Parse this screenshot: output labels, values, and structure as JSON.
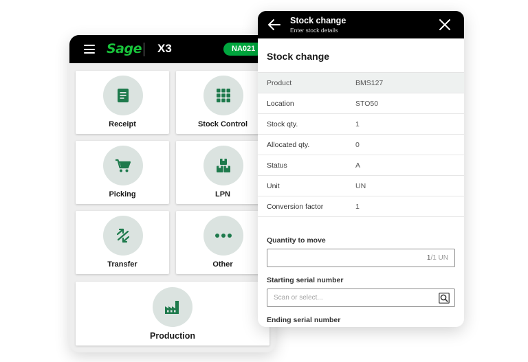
{
  "menu_app": {
    "brand": "Sage",
    "product": "X3",
    "site_badge": "NA021",
    "tiles": [
      {
        "label": "Receipt",
        "icon": "document-icon"
      },
      {
        "label": "Stock Control",
        "icon": "grid-icon"
      },
      {
        "label": "Picking",
        "icon": "cart-icon"
      },
      {
        "label": "LPN",
        "icon": "boxes-icon"
      },
      {
        "label": "Transfer",
        "icon": "transfer-arrows-icon"
      },
      {
        "label": "Other",
        "icon": "more-dots-icon"
      },
      {
        "label": "Production",
        "icon": "factory-icon"
      }
    ],
    "accent_color": "#00a63e",
    "icon_color": "#1e7a4c"
  },
  "stock_change": {
    "header_title": "Stock change",
    "header_subtitle": "Enter stock details",
    "section_title": "Stock change",
    "rows": [
      {
        "key": "Product",
        "value": "BMS127"
      },
      {
        "key": "Location",
        "value": "STO50"
      },
      {
        "key": "Stock qty.",
        "value": "1"
      },
      {
        "key": "Allocated qty.",
        "value": "0"
      },
      {
        "key": "Status",
        "value": "A"
      },
      {
        "key": "Unit",
        "value": "UN"
      },
      {
        "key": "Conversion factor",
        "value": "1"
      }
    ],
    "quantity_label": "Quantity to move",
    "quantity_value": "1",
    "quantity_max": "/1 UN",
    "start_serial_label": "Starting serial number",
    "start_serial_placeholder": "Scan or select...",
    "end_serial_label": "Ending serial number"
  }
}
